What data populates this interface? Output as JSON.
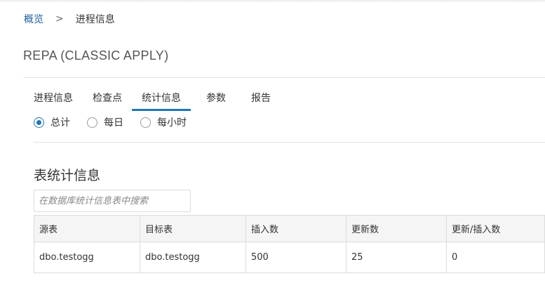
{
  "breadcrumb": {
    "root": "概览",
    "separator": ">",
    "current": "进程信息"
  },
  "page": {
    "title": "REPA (CLASSIC APPLY)"
  },
  "tabs": [
    {
      "label": "进程信息",
      "active": false
    },
    {
      "label": "检查点",
      "active": false
    },
    {
      "label": "统计信息",
      "active": true
    },
    {
      "label": "参数",
      "active": false
    },
    {
      "label": "报告",
      "active": false
    }
  ],
  "radios": [
    {
      "label": "总计",
      "checked": true
    },
    {
      "label": "每日",
      "checked": false
    },
    {
      "label": "每小时",
      "checked": false
    }
  ],
  "section": {
    "title": "表统计信息",
    "search_placeholder": "在数据库统计信息表中搜索"
  },
  "table": {
    "headers": [
      "源表",
      "目标表",
      "插入数",
      "更新数",
      "更新/插入数"
    ],
    "rows": [
      [
        "dbo.testogg",
        "dbo.testogg",
        "500",
        "25",
        "0"
      ]
    ]
  },
  "colors": {
    "accent": "#1f77b4",
    "link": "#1f5f9e"
  }
}
